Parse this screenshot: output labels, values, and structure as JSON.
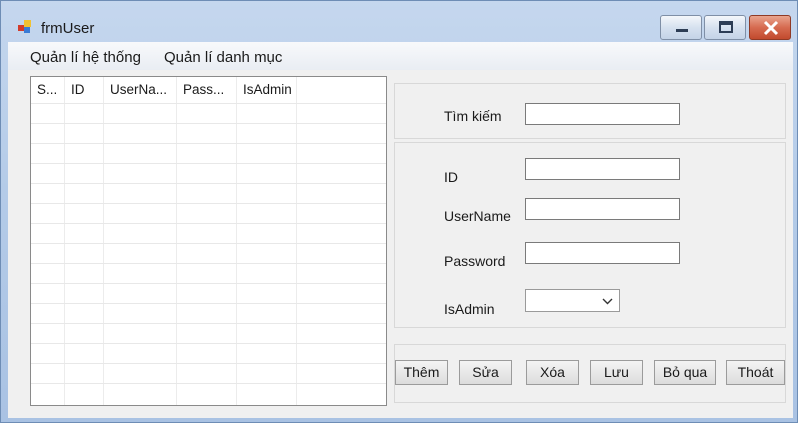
{
  "window": {
    "title": "frmUser"
  },
  "menu": {
    "items": [
      "Quản lí hệ thống",
      "Quản lí danh mục"
    ]
  },
  "grid": {
    "columns": [
      "S...",
      "ID",
      "UserNa...",
      "Pass...",
      "IsAdmin"
    ],
    "rows": []
  },
  "search": {
    "label": "Tìm kiếm",
    "value": ""
  },
  "form": {
    "id_label": "ID",
    "id_value": "",
    "username_label": "UserName",
    "username_value": "",
    "password_label": "Password",
    "password_value": "",
    "isadmin_label": "IsAdmin",
    "isadmin_value": ""
  },
  "buttons": {
    "them": "Thêm",
    "sua": "Sửa",
    "xoa": "Xóa",
    "luu": "Lưu",
    "boqua": "Bỏ qua",
    "thoat": "Thoát"
  },
  "icons": {
    "app": "app-icon",
    "minimize": "minimize-icon",
    "maximize": "maximize-icon",
    "close": "close-icon",
    "dropdown": "chevron-down-icon"
  }
}
